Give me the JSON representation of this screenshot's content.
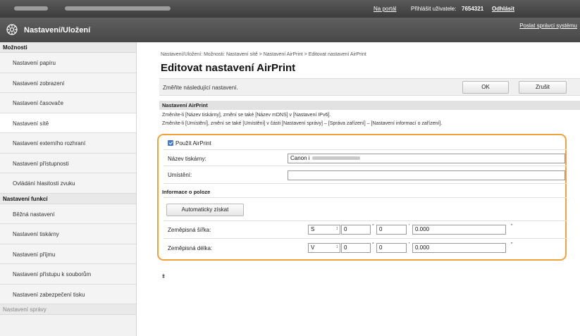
{
  "topbar": {
    "portal_link": "Na portál",
    "login_user_label": "Přihlášit uživatele:",
    "login_user_value": "7654321",
    "logout_link": "Odhlásit"
  },
  "header": {
    "title": "Nastavení/Uložení",
    "mail_link": "Poslat správci systému"
  },
  "sidebar": {
    "sections": [
      {
        "title": "Možnosti",
        "items": [
          "Nastavení papíru",
          "Nastavení zobrazení",
          "Nastavení časovače",
          "Nastavení sítě",
          "Nastavení externího rozhraní",
          "Nastavení přístupnosti",
          "Ovládání hlasitosti zvuku"
        ]
      },
      {
        "title": "Nastavení funkcí",
        "items": [
          "Běžná nastavení",
          "Nastavení tiskárny",
          "Nastavení příjmu",
          "Nastavení přístupu k souborům",
          "Nastavení zabezpečení tisku"
        ]
      }
    ],
    "footer_section": "Nastavení správy",
    "active_item": "Nastavení sítě"
  },
  "main": {
    "breadcrumb": "Nastavení/Uložení: Možnosti: Nastavení sítě > Nastavení AirPrint > Editovat nastavení AirPrint",
    "page_title": "Editovat nastavení AirPrint",
    "instruction": "Změňte následující nastavení.",
    "ok_button": "OK",
    "cancel_button": "Zrušit",
    "section_title": "Nastavení AirPrint",
    "note_1": "Změníte-li [Název tiskárny], změní se také [Název mDNS] v [Nastavení IPv6].",
    "note_2": "Změníte-li [Umístění], změní se také [Umístění] v části [Nastavení správy] – [Správa zařízení] – [Nastavení informací o zařízení].",
    "use_airprint_label": "Použít AirPrint",
    "use_airprint_checked": true,
    "printer_name_label": "Název tiskárny:",
    "printer_name_value": "Canon i",
    "location_label": "Umístění:",
    "location_value": "",
    "position_section": "Informace o poloze",
    "auto_get_button": "Automaticky získat",
    "latitude_label": "Zeměpisná šířka:",
    "latitude": {
      "dir": "S",
      "deg": "0",
      "min": "0",
      "sec": "0.000"
    },
    "longitude_label": "Zeměpisná délka:",
    "longitude": {
      "dir": "V",
      "deg": "0",
      "min": "0",
      "sec": "0.000"
    },
    "degree_symbol": "°",
    "minute_symbol": "'",
    "second_symbol": "\"",
    "back_to_top_icon": "⯒"
  },
  "colors": {
    "highlight_border": "#f0a33c",
    "header_bg": "#474747"
  }
}
